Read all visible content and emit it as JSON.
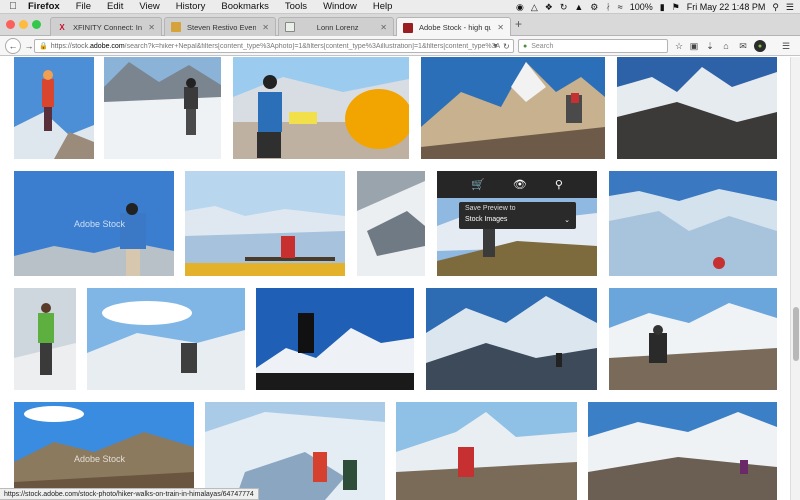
{
  "menubar": {
    "apple": "",
    "app_name": "Firefox",
    "items": [
      "File",
      "Edit",
      "View",
      "History",
      "Bookmarks",
      "Tools",
      "Window",
      "Help"
    ],
    "battery": "100%",
    "clock": "Fri May 22  1:48 PM"
  },
  "tabs": [
    {
      "title": "XFINITY Connect: Inbox (863)",
      "favicon": "xfinity-icon",
      "active": false
    },
    {
      "title": "Steven Restivo Event Servic...",
      "favicon": "restivo-icon",
      "active": false
    },
    {
      "title": "Lonn Lorenz",
      "favicon": "page-icon",
      "active": false
    },
    {
      "title": "Adobe Stock - high quality r...",
      "favicon": "adobe-stock-icon",
      "active": true
    }
  ],
  "navbar": {
    "url_prefix": "https://stock.",
    "url_domain": "adobe.com",
    "url_rest": "/search?k=hiker+Nepal&filters[content_type%3Aphoto]=1&filters[content_type%3Aillustration]=1&filters[content_type%3A",
    "search_placeholder": "Search"
  },
  "hover_tools": {
    "icons": [
      "add-to-cart-icon",
      "preview-eye-icon",
      "find-similar-icon"
    ],
    "save_label": "Save Preview to",
    "save_value": "Stock Images"
  },
  "watermark": "Adobe Stock",
  "status_url": "https://stock.adobe.com/stock-photo/hiker-walks-on-train-in-himalayas/64747774",
  "colors": {
    "sky_blue": "#2b6fb8",
    "snow": "#e8eef3",
    "rock": "#6e5a48",
    "toolbar_dark": "#262626"
  }
}
